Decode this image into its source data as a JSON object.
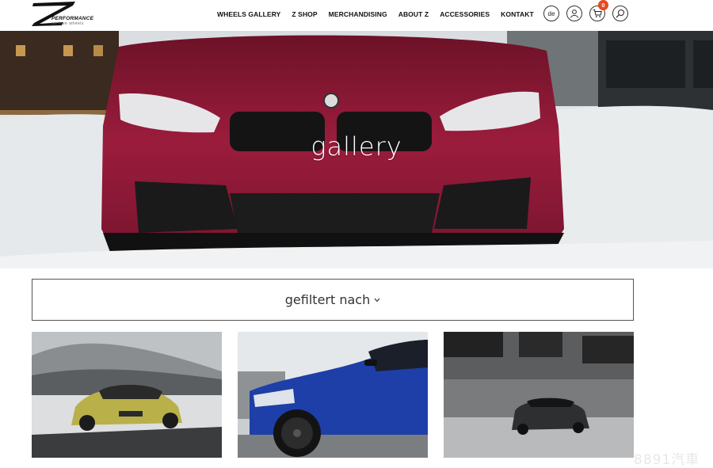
{
  "header": {
    "logo": {
      "brand": "PERFORMANCE",
      "tagline": "we love wheels"
    },
    "nav": [
      {
        "label": "WHEELS GALLERY"
      },
      {
        "label": "Z SHOP"
      },
      {
        "label": "MERCHANDISING"
      },
      {
        "label": "ABOUT Z"
      },
      {
        "label": "ACCESSORIES"
      },
      {
        "label": "KONTAKT"
      }
    ],
    "language": "de",
    "cart_count": "0",
    "icons": [
      "user-icon",
      "cart-icon",
      "search-icon"
    ]
  },
  "hero": {
    "title": "gallery"
  },
  "filter": {
    "label": "gefiltert nach"
  },
  "gallery": {
    "tiles": [
      {
        "name": "gallery-tile-yellow-car"
      },
      {
        "name": "gallery-tile-blue-car"
      },
      {
        "name": "gallery-tile-dark-car"
      }
    ]
  },
  "watermark": "8891汽車",
  "colors": {
    "badge": "#e8491d",
    "car_red": "#9b1c3c",
    "car_blue": "#1e3fa8"
  }
}
